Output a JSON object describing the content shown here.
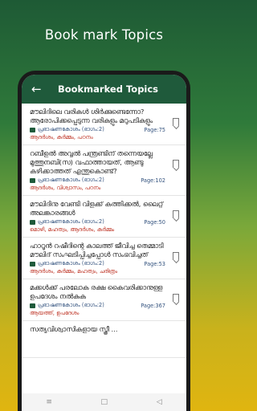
{
  "promo": {
    "title": "Book mark Topics"
  },
  "appbar": {
    "title": "Bookmarked Topics"
  },
  "items": [
    {
      "title": "മൗലിദിലെ വരികൾ ശിർക്കുണ്ടെന്നോ? ആരോപിക്കപ്പെടുന്ന വരികളും മറുപടികളും",
      "book": "പ്രഭാഷണകോശം (ഭാഗം:2)",
      "page": "Page:75",
      "tags": "ആദർശം, കർമ്മം, പഠനം"
    },
    {
      "title": "റബീഉൽ അവ്വൽ പന്ത്രണ്ടിന് തന്നെയല്ലേ മുത്തുനബി(സ) വഫാത്തായത്, ആണ്ടു കഴിക്കാത്തത് എന്തുകൊണ്ട്?",
      "book": "പ്രഭാഷണകോശം (ഭാഗം:2)",
      "page": "Page:102",
      "tags": "ആദർശം, വിശ്വാസം, പഠനം"
    },
    {
      "title": "മൗലിദിനു വേണ്ടി വിളക്ക് കത്തിക്കൽ, ലൈറ്റ് അലങ്കാരങ്ങൾ",
      "book": "പ്രഭാഷണകോശം (ഭാഗം:2)",
      "page": "Page:50",
      "tags": "മൊഴി, മഹത്വം, ആദർശം, കർമ്മം"
    },
    {
      "title": "ഹാറൂൻ റഷീദിന്റെ കാലത്ത് ജീവിച്ച തെമ്മാടി മൗലിദ് സംഘടിപ്പിച്ചപ്പോൾ സംഭവിച്ചത്",
      "book": "പ്രഭാഷണകോശം (ഭാഗം:2)",
      "page": "Page:53",
      "tags": "ആദർശം, കർമ്മം, മഹത്വം, ചരിത്രം"
    },
    {
      "title": "മക്കൾക്ക് പരലോക രക്ഷ കൈവരിക്കാനുള്ള ഉപദേശം നൽകുക",
      "book": "പ്രഭാഷണകോശം (ഭാഗം:2)",
      "page": "Page:367",
      "tags": "ആയത്ത്, ഉപദേശം"
    },
    {
      "title": "സത്യവിശ്വാസികളായ സ്ത്രീ ...",
      "book": "",
      "page": "",
      "tags": ""
    }
  ],
  "navbar": {
    "menu": "≡",
    "home": "□",
    "back": "◁"
  }
}
